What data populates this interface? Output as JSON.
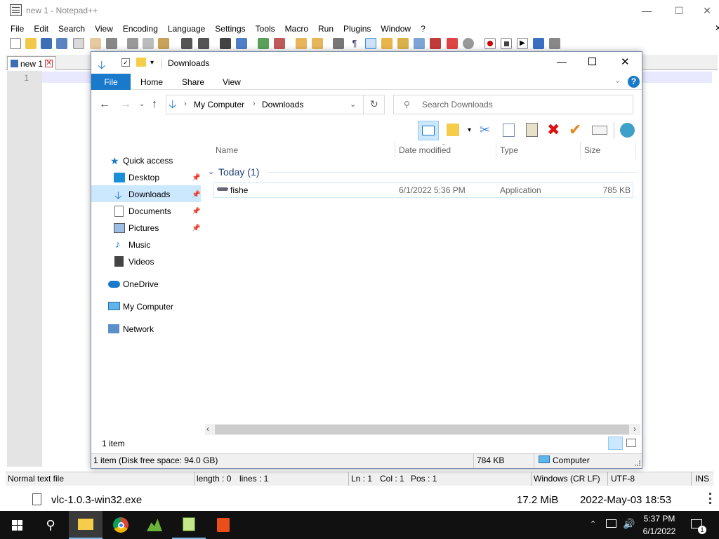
{
  "npp": {
    "title": "new 1 - Notepad++",
    "menu": [
      "File",
      "Edit",
      "Search",
      "View",
      "Encoding",
      "Language",
      "Settings",
      "Tools",
      "Macro",
      "Run",
      "Plugins",
      "Window",
      "?"
    ],
    "tab_label": "new 1",
    "line_number": "1",
    "status": {
      "file_type": "Normal text file",
      "length": "length : 0",
      "lines": "lines : 1",
      "ln": "Ln : 1",
      "col": "Col : 1",
      "pos": "Pos : 1",
      "eol": "Windows (CR LF)",
      "encoding": "UTF-8",
      "mode": "INS"
    }
  },
  "download": {
    "filename": "vlc-1.0.3-win32.exe",
    "size": "17.2 MiB",
    "date": "2022-May-03 18:53"
  },
  "explorer": {
    "title": "Downloads",
    "ribbon_tabs": [
      "File",
      "Home",
      "Share",
      "View"
    ],
    "breadcrumb": [
      "My Computer",
      "Downloads"
    ],
    "search_placeholder": "Search Downloads",
    "nav": {
      "quick_access": "Quick access",
      "desktop": "Desktop",
      "downloads": "Downloads",
      "documents": "Documents",
      "pictures": "Pictures",
      "music": "Music",
      "videos": "Videos",
      "onedrive": "OneDrive",
      "my_computer": "My Computer",
      "network": "Network"
    },
    "columns": {
      "name": "Name",
      "date": "Date modified",
      "type": "Type",
      "size": "Size"
    },
    "group": "Today (1)",
    "file": {
      "name": "fishe",
      "date": "6/1/2022 5:36 PM",
      "type": "Application",
      "size": "785 KB"
    },
    "item_count": "1 item",
    "status_left": "1 item (Disk free space: 94.0 GB)",
    "status_size": "784 KB",
    "status_location": "Computer"
  },
  "taskbar": {
    "time": "5:37 PM",
    "date": "6/1/2022",
    "notif_count": "1"
  },
  "colors": {
    "accent": "#1979ca",
    "selection": "#cce8ff",
    "taskbar": "#111111"
  }
}
